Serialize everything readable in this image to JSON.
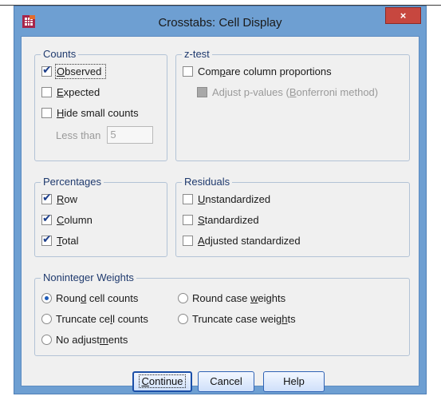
{
  "window": {
    "title": "Crosstabs: Cell Display",
    "close_glyph": "×",
    "app_icon": "spss-crosstabs-icon"
  },
  "counts": {
    "legend": "Counts",
    "observed": {
      "pre": "",
      "key": "O",
      "post": "bserved",
      "checked": true
    },
    "expected": {
      "pre": "",
      "key": "E",
      "post": "xpected",
      "checked": false
    },
    "hide_small": {
      "pre": "",
      "key": "H",
      "post": "ide small counts",
      "checked": false
    },
    "less_than_label": "Less than",
    "less_than_value": "5"
  },
  "ztest": {
    "legend": "z-test",
    "compare": {
      "pre": "Com",
      "key": "p",
      "post": "are column proportions",
      "checked": false
    },
    "adjust": {
      "pre": "Adjust p-values (",
      "key": "B",
      "post": "onferroni method)",
      "checked": false,
      "disabled": true
    }
  },
  "percentages": {
    "legend": "Percentages",
    "row": {
      "pre": "",
      "key": "R",
      "post": "ow",
      "checked": true
    },
    "column": {
      "pre": "",
      "key": "C",
      "post": "olumn",
      "checked": true
    },
    "total": {
      "pre": "",
      "key": "T",
      "post": "otal",
      "checked": true
    }
  },
  "residuals": {
    "legend": "Residuals",
    "unstandardized": {
      "pre": "",
      "key": "U",
      "post": "nstandardized",
      "checked": false
    },
    "standardized": {
      "pre": "",
      "key": "S",
      "post": "tandardized",
      "checked": false
    },
    "adjusted": {
      "pre": "",
      "key": "A",
      "post": "djusted standardized",
      "checked": false
    }
  },
  "weights": {
    "legend": "Noninteger Weights",
    "round_cell": {
      "pre": "Roun",
      "key": "d",
      "post": " cell counts",
      "selected": true
    },
    "round_case": {
      "pre": "Round case ",
      "key": "w",
      "post": "eights",
      "selected": false
    },
    "truncate_cell": {
      "pre": "Truncate ce",
      "key": "l",
      "post": "l counts",
      "selected": false
    },
    "truncate_case": {
      "pre": "Truncate case weig",
      "key": "h",
      "post": "ts",
      "selected": false
    },
    "no_adjust": {
      "pre": "No adjust",
      "key": "m",
      "post": "ents",
      "selected": false
    }
  },
  "buttons": {
    "continue": {
      "pre": "",
      "key": "C",
      "post": "ontinue"
    },
    "cancel": "Cancel",
    "help": "Help"
  },
  "colors": {
    "title_bar": "#6e9fd2",
    "close_button": "#c7473f",
    "dialog_bg": "#f0f0f0",
    "group_legend": "#1f3a6e",
    "button_border": "#2f63b5"
  }
}
